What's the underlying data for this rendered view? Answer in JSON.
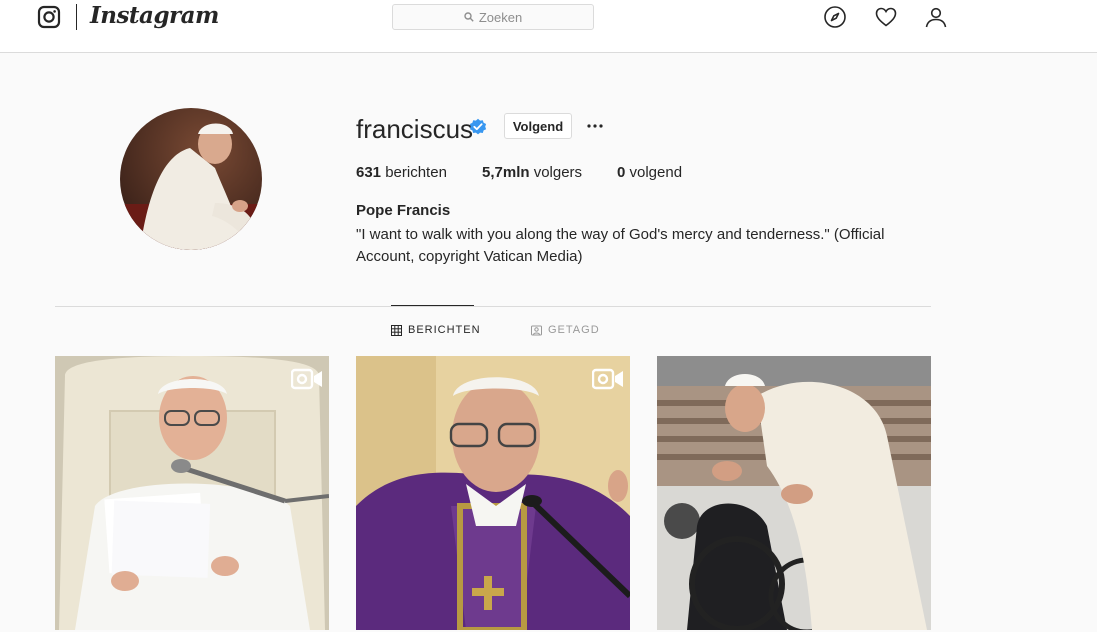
{
  "nav": {
    "brand": "Instagram",
    "search_placeholder": "Zoeken"
  },
  "profile": {
    "username": "franciscus",
    "verified": true,
    "follow_label": "Volgend",
    "stats": {
      "posts_count": "631",
      "posts_label": " berichten",
      "followers_count": "5,7mln",
      "followers_label": " volgers",
      "following_count": "0",
      "following_label": " volgend"
    },
    "full_name": "Pope Francis",
    "bio": "\"I want to walk with you along the way of God's mercy and tenderness.\" (Official Account, copyright Vatican Media)"
  },
  "tabs": [
    {
      "label": "BERICHTEN",
      "active": true
    },
    {
      "label": "GETAGD",
      "active": false
    }
  ],
  "posts": [
    {
      "type": "video",
      "alt": "photo-1"
    },
    {
      "type": "video",
      "alt": "photo-2"
    },
    {
      "type": "image",
      "alt": "photo-3"
    }
  ],
  "colors": {
    "accent_verified": "#3897f0",
    "border": "#dbdbdb",
    "text": "#262626",
    "muted": "#8e8e8e"
  },
  "icons": [
    "instagram-logo-icon",
    "search-icon",
    "compass-icon",
    "heart-icon",
    "user-icon",
    "verified-badge-icon",
    "more-options-icon",
    "grid-icon",
    "tagged-icon",
    "video-icon"
  ]
}
